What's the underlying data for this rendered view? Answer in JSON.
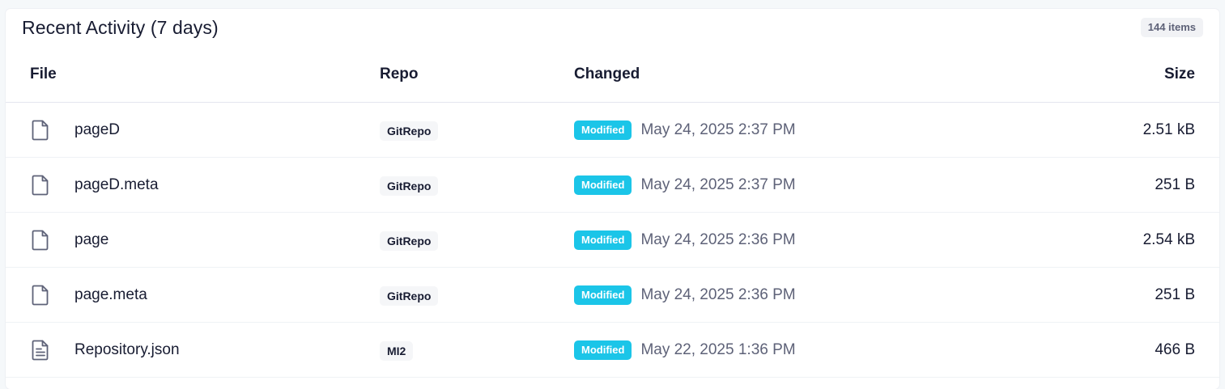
{
  "panel": {
    "title": "Recent Activity (7 days)",
    "item_count": "144 items"
  },
  "table": {
    "columns": {
      "file": "File",
      "repo": "Repo",
      "changed": "Changed",
      "size": "Size"
    },
    "rows": [
      {
        "file": "pageD",
        "icon": "file-icon",
        "repo": "GitRepo",
        "status": "Modified",
        "timestamp": "May 24, 2025 2:37 PM",
        "size": "2.51 kB"
      },
      {
        "file": "pageD.meta",
        "icon": "file-icon",
        "repo": "GitRepo",
        "status": "Modified",
        "timestamp": "May 24, 2025 2:37 PM",
        "size": "251 B"
      },
      {
        "file": "page",
        "icon": "file-icon",
        "repo": "GitRepo",
        "status": "Modified",
        "timestamp": "May 24, 2025 2:36 PM",
        "size": "2.54 kB"
      },
      {
        "file": "page.meta",
        "icon": "file-icon",
        "repo": "GitRepo",
        "status": "Modified",
        "timestamp": "May 24, 2025 2:36 PM",
        "size": "251 B"
      },
      {
        "file": "Repository.json",
        "icon": "file-text-icon",
        "repo": "MI2",
        "status": "Modified",
        "timestamp": "May 22, 2025 1:36 PM",
        "size": "466 B"
      }
    ]
  },
  "colors": {
    "status_modified": "#1bc5e8",
    "text_primary": "#181c32",
    "text_muted": "#5e6278"
  }
}
